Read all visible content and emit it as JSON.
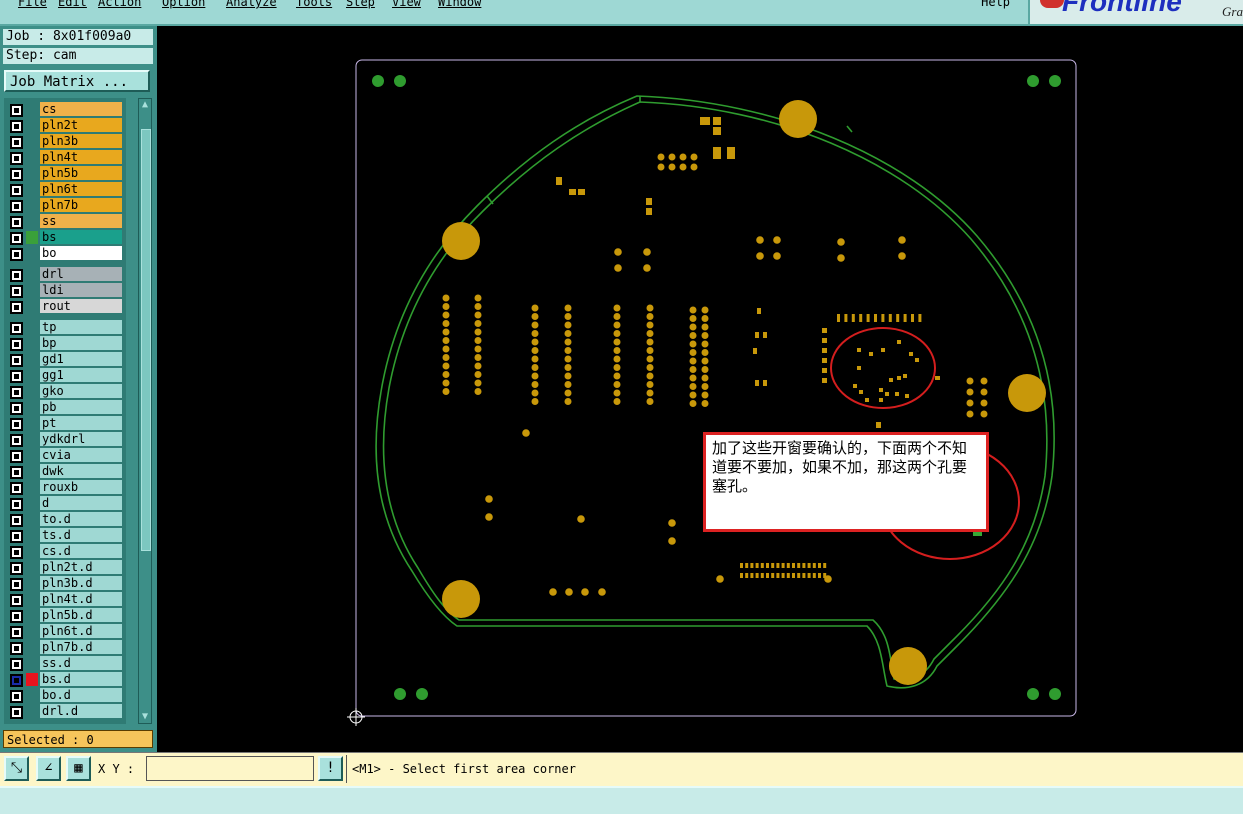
{
  "menubar": {
    "items": [
      "File",
      "Edit",
      "Action",
      "Option",
      "Analyze",
      "Tools",
      "Step",
      "View",
      "Window"
    ],
    "help": "Help"
  },
  "brand": {
    "logo": "Frontline",
    "sub": "Gra"
  },
  "job": {
    "job_label": "Job : 8x01f009a0",
    "step_label": "Step: cam",
    "matrix_button": "Job Matrix ..."
  },
  "layers": {
    "board": [
      {
        "name": "cs",
        "color": "#f0b14a"
      },
      {
        "name": "pln2t",
        "color": "#e8a81e"
      },
      {
        "name": "pln3b",
        "color": "#e8a81e"
      },
      {
        "name": "pln4t",
        "color": "#e8a81e"
      },
      {
        "name": "pln5b",
        "color": "#e8a81e"
      },
      {
        "name": "pln6t",
        "color": "#e8a81e"
      },
      {
        "name": "pln7b",
        "color": "#e8a81e"
      },
      {
        "name": "ss",
        "color": "#f0b14a"
      },
      {
        "name": "bs",
        "color": "#1aa08c",
        "active": true
      },
      {
        "name": "bo",
        "color": "#ffffff"
      }
    ],
    "drill": [
      {
        "name": "drl",
        "color": "#a7b1b6"
      },
      {
        "name": "ldi",
        "color": "#a7b1b6"
      },
      {
        "name": "rout",
        "color": "#d7d7d7"
      }
    ],
    "misc": [
      {
        "name": "tp"
      },
      {
        "name": "bp"
      },
      {
        "name": "gd1"
      },
      {
        "name": "gg1"
      },
      {
        "name": "gko"
      },
      {
        "name": "pb"
      },
      {
        "name": "pt"
      },
      {
        "name": "ydkdrl"
      },
      {
        "name": "cvia"
      },
      {
        "name": "dwk"
      },
      {
        "name": "rouxb"
      },
      {
        "name": "d"
      },
      {
        "name": "to.d"
      },
      {
        "name": "ts.d"
      },
      {
        "name": "cs.d"
      },
      {
        "name": "pln2t.d"
      },
      {
        "name": "pln3b.d"
      },
      {
        "name": "pln4t.d"
      },
      {
        "name": "pln5b.d"
      },
      {
        "name": "pln6t.d"
      },
      {
        "name": "pln7b.d"
      },
      {
        "name": "ss.d"
      },
      {
        "name": "bs.d",
        "marked": true
      },
      {
        "name": "bo.d"
      },
      {
        "name": "drl.d"
      }
    ]
  },
  "selected": "Selected : 0",
  "annotation": "加了这些开窗要确认的，下面两个不知道要不要加，如果不加，那这两个孔要塞孔。",
  "status": {
    "xy_label": "X Y :",
    "xy_value": "",
    "exclaim": "!",
    "message": "<M1> - Select first area corner"
  },
  "colors": {
    "pad": "#c8980a",
    "outline": "#2f9c2f",
    "circle": "#d41e1e",
    "panel": "#9fd8d3"
  }
}
